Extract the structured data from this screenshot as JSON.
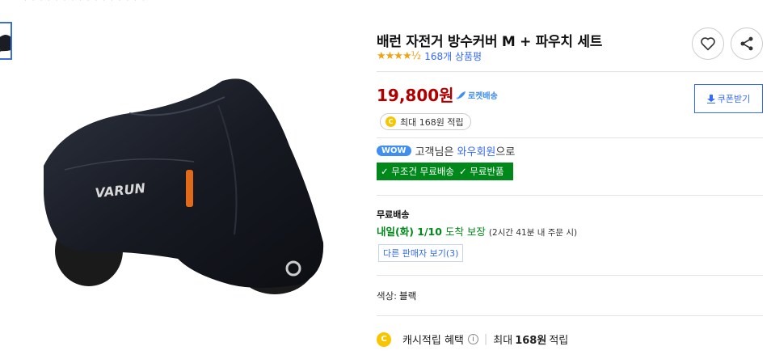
{
  "breadcrumb": "· · · · · · · · · · · · · · · ·",
  "product": {
    "title": "배런 자전거 방수커버 M + 파우치 세트",
    "stars": "★★★★½",
    "review_count": "168개 상품평",
    "rating": 4.5
  },
  "price": {
    "value": "19,800원",
    "rocket_label": "로켓배송"
  },
  "coupon_button": "쿠폰받기",
  "cash_pill": {
    "coin_letter": "C",
    "text": "최대 168원 적립"
  },
  "wow": {
    "badge": "WOW",
    "prefix": "고객님은",
    "member": "와우회원",
    "suffix": "으로"
  },
  "benefits": {
    "free_shipping": "✓ 무조건 무료배송",
    "free_return": "✓ 무료반품"
  },
  "shipping": {
    "label": "무료배송",
    "date": "내일(화) 1/10",
    "guarantee": "도착 보장",
    "note": "(2시간 41분 내 주문 시)"
  },
  "other_sellers": "다른 판매자 보기(3)",
  "option": {
    "label": "색상:",
    "value": "블랙"
  },
  "cash_benefit": {
    "coin_letter": "C",
    "label": "캐시적립 혜택",
    "info": "i",
    "separator": "|",
    "max_label": "최대",
    "amount": "168원",
    "suffix": "적립"
  },
  "image": {
    "brand_text": "VARUN"
  },
  "colors": {
    "price_red": "#ae0000",
    "link_blue": "#346aff",
    "rocket_blue": "#3f8ef0",
    "green": "#00891a",
    "star": "#f5a011",
    "coin": "#f7c600"
  }
}
